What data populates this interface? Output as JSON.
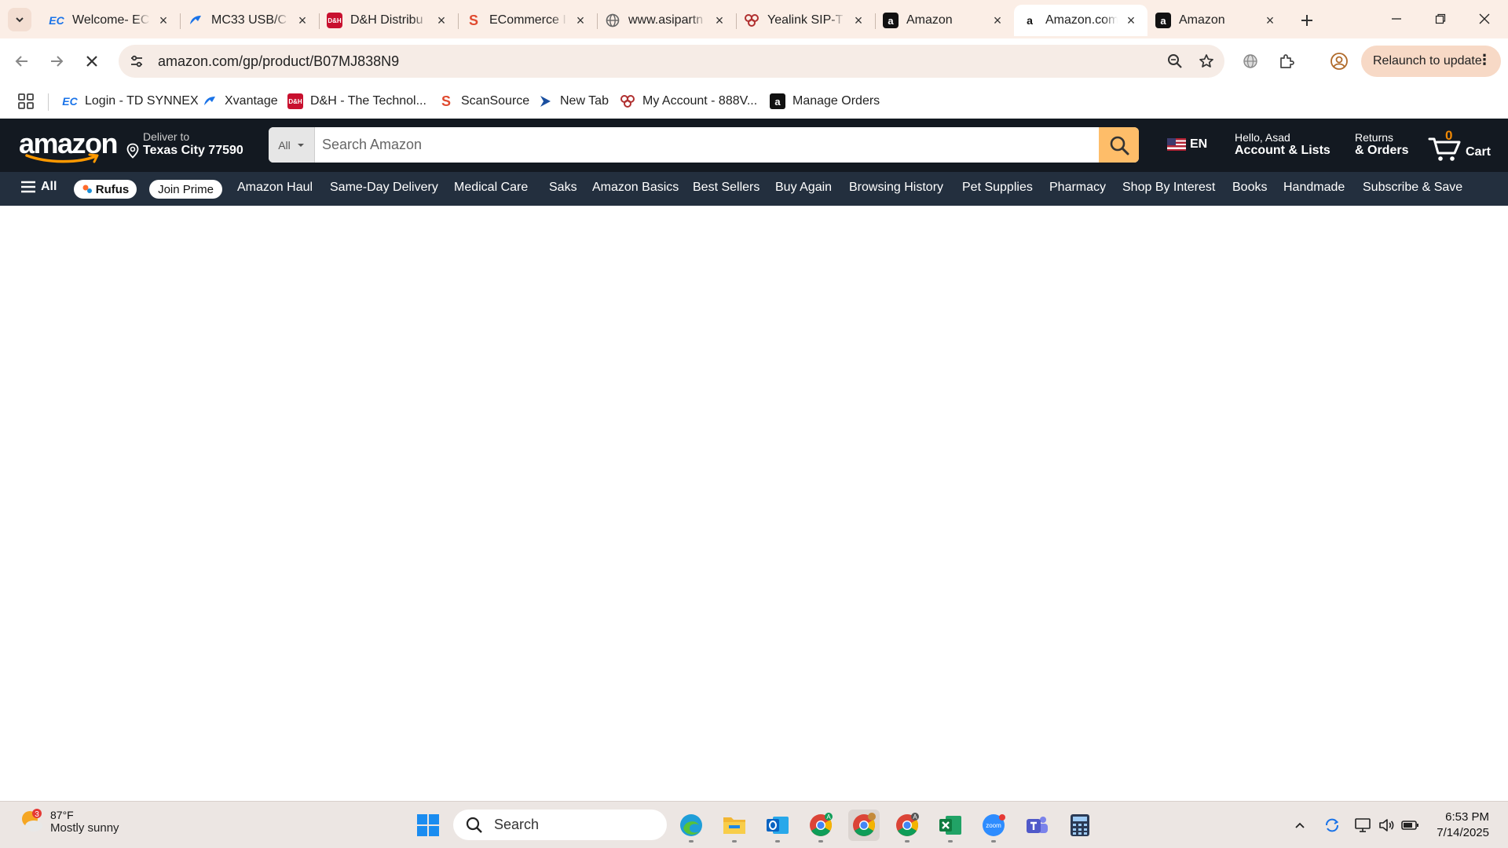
{
  "browser": {
    "tabs": [
      {
        "title": "Welcome- EC",
        "favicon": "ec-icon",
        "color": "#1a73e8"
      },
      {
        "title": "MC33 USB/C",
        "favicon": "xvantage-icon",
        "color": "#1a73e8"
      },
      {
        "title": "D&H Distribu",
        "favicon": "dh-icon",
        "color": "#c8102e"
      },
      {
        "title": "ECommerce I",
        "favicon": "scansource-icon",
        "color": "#e04a2f"
      },
      {
        "title": "www.asipartn",
        "favicon": "globe-icon",
        "color": "#666666"
      },
      {
        "title": "Yealink SIP-T",
        "favicon": "888-icon",
        "color": "#b03030"
      },
      {
        "title": "Amazon",
        "favicon": "amazon-icon",
        "color": "#111111"
      },
      {
        "title": "Amazon.com",
        "favicon": "amazon-icon",
        "color": "#111111",
        "active": true
      },
      {
        "title": "Amazon",
        "favicon": "amazon-icon",
        "color": "#111111"
      }
    ],
    "url": "amazon.com/gp/product/B07MJ838N9",
    "relaunch_label": "Relaunch to update",
    "bookmarks": [
      {
        "label": "Login - TD SYNNEX"
      },
      {
        "label": "Xvantage"
      },
      {
        "label": "D&H - The Technol..."
      },
      {
        "label": "ScanSource"
      },
      {
        "label": "New Tab"
      },
      {
        "label": "My Account - 888V..."
      },
      {
        "label": "Manage Orders"
      }
    ]
  },
  "amazon": {
    "logo_text": "amazon",
    "deliver_line1": "Deliver to",
    "deliver_line2": "Texas City 77590",
    "search_category": "All",
    "search_placeholder": "Search Amazon",
    "language": "EN",
    "account_line1": "Hello, Asad",
    "account_line2": "Account & Lists",
    "returns_line1": "Returns",
    "returns_line2": "& Orders",
    "cart_count": "0",
    "cart_label": "Cart",
    "nav_all": "All",
    "rufus": "Rufus",
    "join_prime": "Join Prime",
    "nav_links": [
      "Amazon Haul",
      "Same-Day Delivery",
      "Medical Care",
      "Saks",
      "Amazon Basics",
      "Best Sellers",
      "Buy Again",
      "Browsing History",
      "Pet Supplies",
      "Pharmacy",
      "Shop By Interest",
      "Books",
      "Handmade",
      "Subscribe & Save"
    ]
  },
  "taskbar": {
    "weather_badge": "3",
    "weather_temp": "87°F",
    "weather_cond": "Mostly sunny",
    "search_label": "Search",
    "time": "6:53 PM",
    "date": "7/14/2025"
  }
}
